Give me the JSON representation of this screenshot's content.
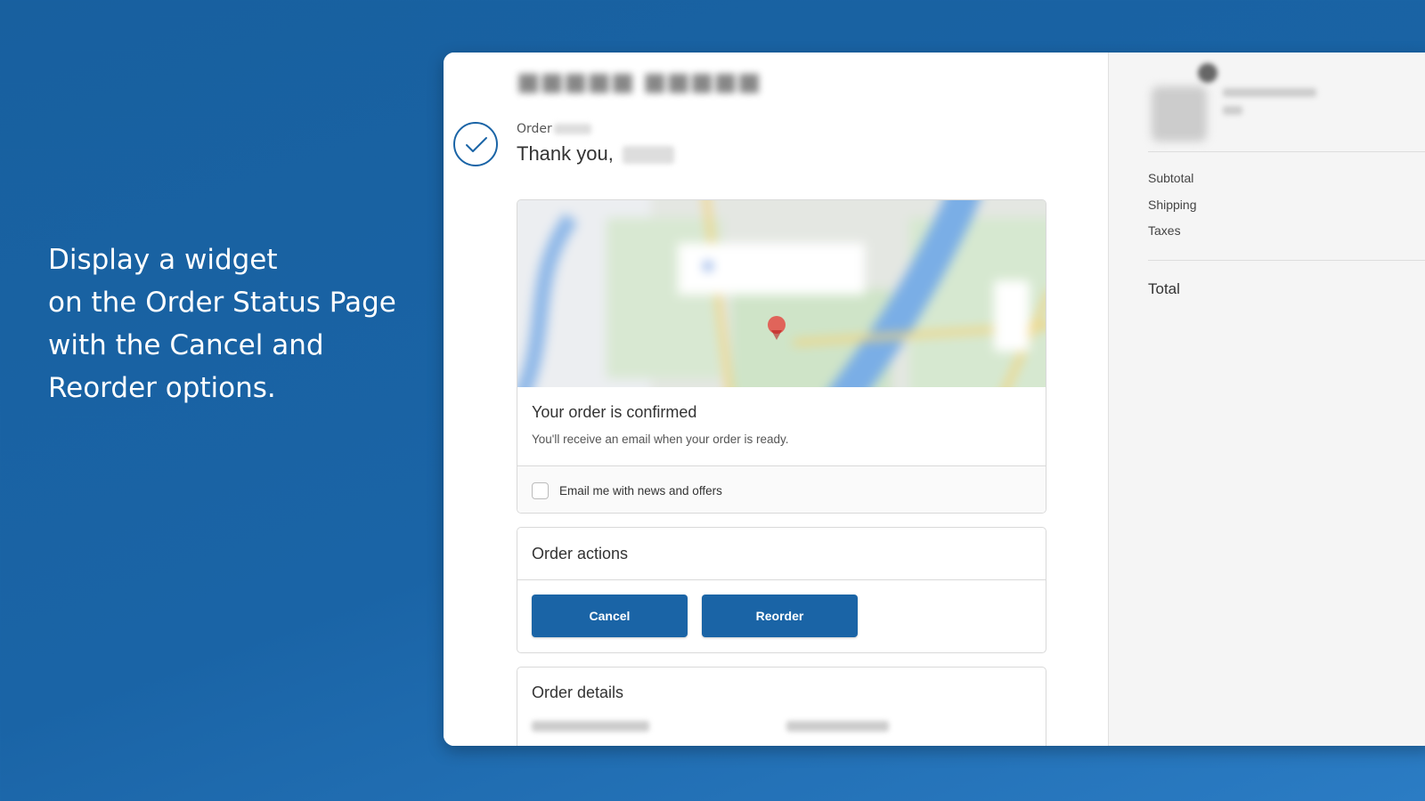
{
  "promo": {
    "line1": "Display a widget",
    "line2": "on the Order Status Page",
    "line3": "with the Cancel and",
    "line4": "Reorder options."
  },
  "header": {
    "order_label": "Order",
    "thank_you": "Thank you,"
  },
  "confirmation": {
    "title": "Your order is confirmed",
    "subtitle": "You'll receive an email when your order is ready.",
    "newsletter_label": "Email me with news and offers"
  },
  "order_actions": {
    "title": "Order actions",
    "cancel_label": "Cancel",
    "reorder_label": "Reorder"
  },
  "order_details": {
    "title": "Order details"
  },
  "summary": {
    "subtotal_label": "Subtotal",
    "shipping_label": "Shipping",
    "taxes_label": "Taxes",
    "total_label": "Total"
  },
  "colors": {
    "accent": "#1a64a6",
    "background": "#1a64a6",
    "sidebar": "#f5f5f5"
  },
  "icons": {
    "confirmation": "check-icon",
    "map_pin": "map-pin-icon"
  }
}
